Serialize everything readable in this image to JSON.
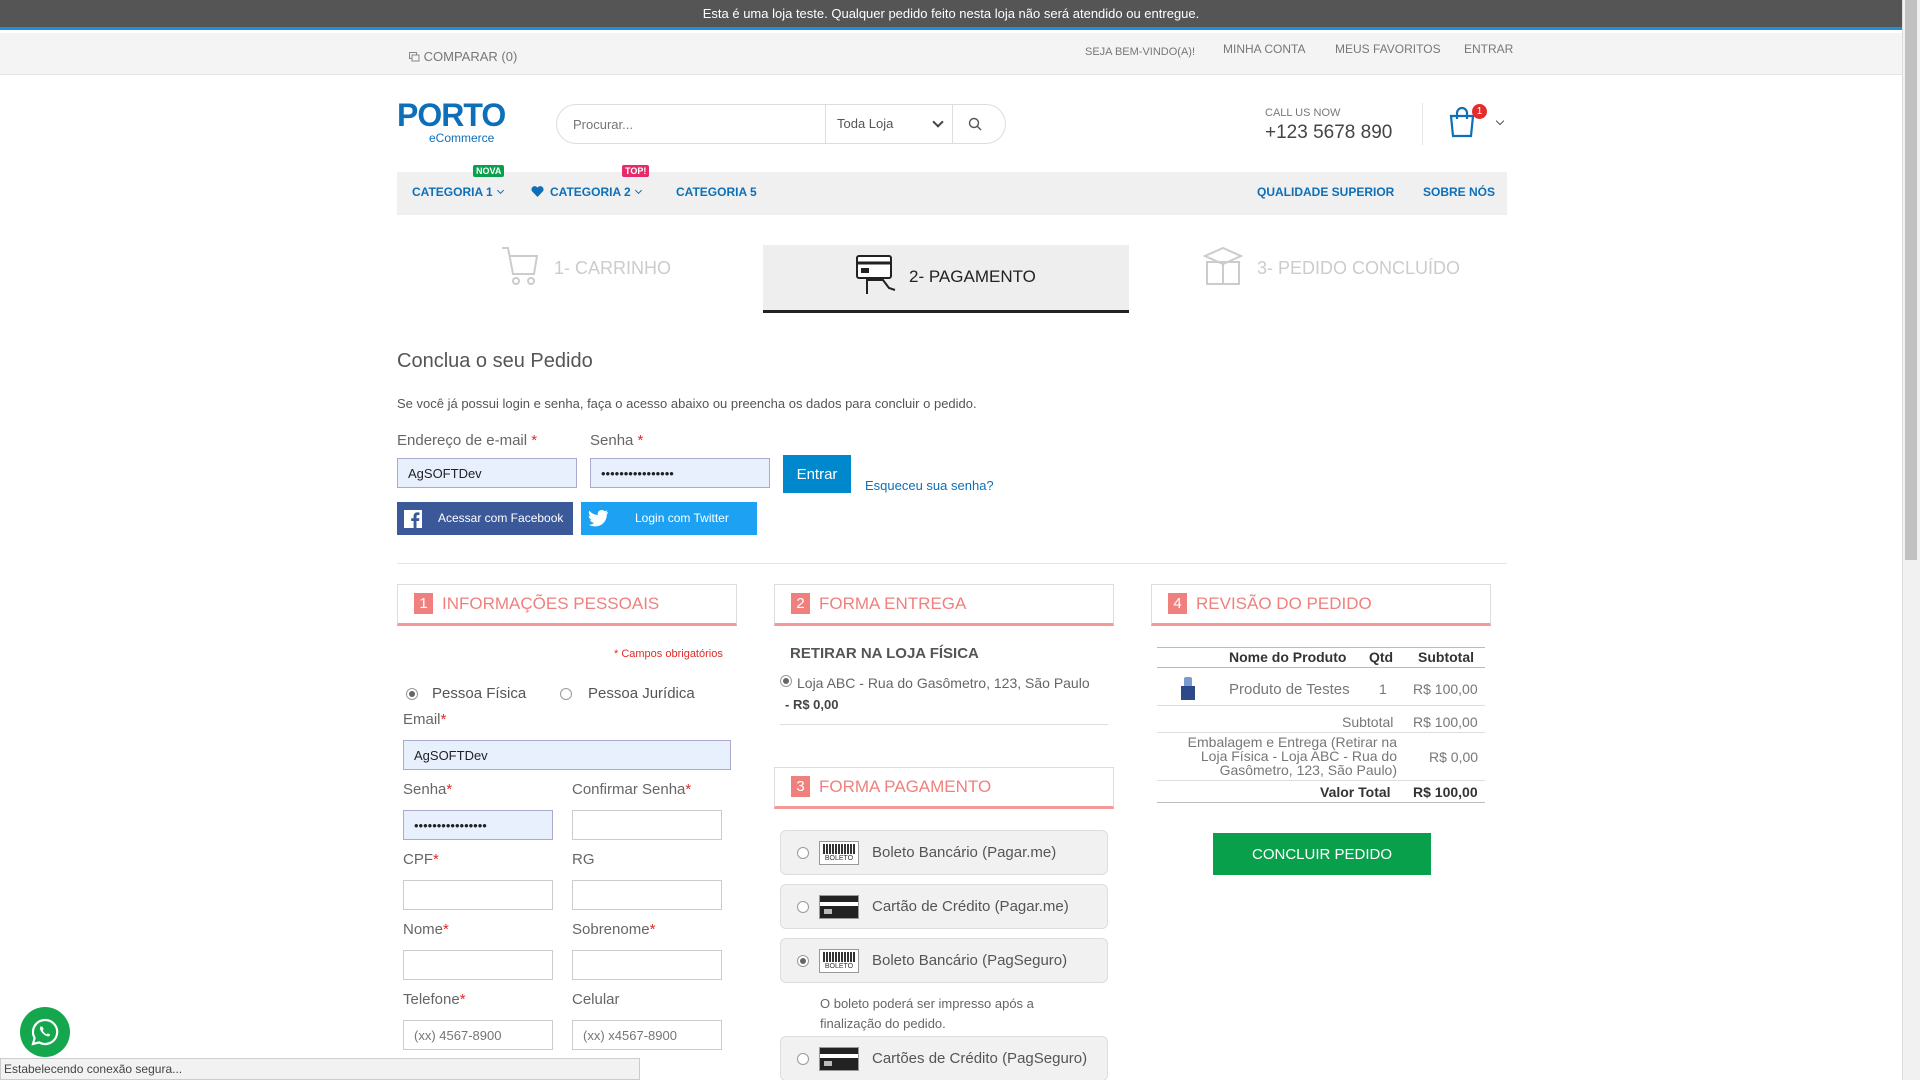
{
  "notice": "Esta é uma loja teste. Qualquer pedido feito nesta loja não será atendido ou entregue.",
  "toplinks": {
    "compare": "COMPARAR (0)",
    "welcome": "SEJA BEM-VINDO(A)!",
    "account": "MINHA CONTA",
    "favorites": "MEUS FAVORITOS",
    "login": "ENTRAR"
  },
  "header": {
    "logo": "PORTO",
    "logo_sub": "eCommerce",
    "search_placeholder": "Procurar...",
    "search_scope": "Toda Loja",
    "call_label": "CALL US NOW",
    "call_number": "+123 5678 890",
    "cart_count": "1"
  },
  "nav": {
    "cat1": "CATEGORIA 1",
    "cat1_tag": "NOVA",
    "cat2": "CATEGORIA 2",
    "cat2_tag": "TOP!",
    "cat5": "CATEGORIA 5",
    "quality": "QUALIDADE SUPERIOR",
    "about": "SOBRE NÓS"
  },
  "steps": [
    "1- CARRINHO",
    "2- PAGAMENTO",
    "3- PEDIDO CONCLUÍDO"
  ],
  "login": {
    "title": "Conclua o seu Pedido",
    "intro": "Se você já possui login e senha, faça o acesso abaixo ou preencha os dados para concluir o pedido.",
    "email_label": "Endereço de e-mail",
    "email_value": "AgSOFTDev",
    "password_label": "Senha",
    "password_value": "••••••••••••••••",
    "enter_button": "Entrar",
    "forgot": "Esqueceu sua senha?",
    "facebook": "Acessar com Facebook",
    "twitter": "Login com Twitter"
  },
  "personal": {
    "num": "1",
    "title": "INFORMAÇÕES PESSOAIS",
    "required_note": "* Campos obrigatórios",
    "type_fisica": "Pessoa Física",
    "type_juridica": "Pessoa Jurídica",
    "email_label": "Email",
    "email_value": "AgSOFTDev",
    "senha_label": "Senha",
    "senha_value": "••••••••••••••••",
    "confirm_label": "Confirmar Senha",
    "cpf_label": "CPF",
    "rg_label": "RG",
    "nome_label": "Nome",
    "sobrenome_label": "Sobrenome",
    "telefone_label": "Telefone",
    "telefone_placeholder": "(xx) 4567-8900",
    "celular_label": "Celular",
    "celular_placeholder": "(xx) x4567-8900"
  },
  "delivery": {
    "num": "2",
    "title": "FORMA ENTREGA",
    "subtitle": "RETIRAR NA LOJA FÍSICA",
    "option": "Loja ABC - Rua do Gasômetro, 123, São Paulo",
    "price_prefix": "- ",
    "price": "R$ 0,00"
  },
  "payment": {
    "num": "3",
    "title": "FORMA PAGAMENTO",
    "options": [
      "Boleto Bancário (Pagar.me)",
      "Cartão de Crédito (Pagar.me)",
      "Boleto Bancário (PagSeguro)",
      "Cartões de Crédito (PagSeguro)"
    ],
    "boleto_label": "BOLETO",
    "note_line1": "O boleto poderá ser impresso após a",
    "note_line2": "finalização do pedido."
  },
  "review": {
    "num": "4",
    "title": "REVISÃO DO PEDIDO",
    "col_product": "Nome do Produto",
    "col_qty": "Qtd",
    "col_subtotal": "Subtotal",
    "product_name": "Produto de Testes",
    "product_qty": "1",
    "product_subtotal": "R$ 100,00",
    "subtotal_label": "Subtotal",
    "subtotal_value": "R$ 100,00",
    "shipping_l1": "Embalagem e Entrega (Retirar na",
    "shipping_l2": "Loja Física - Loja ABC - Rua do",
    "shipping_l3": "Gasômetro, 123, São Paulo)",
    "shipping_value": "R$ 0,00",
    "total_label": "Valor Total",
    "total_value": "R$ 100,00",
    "button": "CONCLUIR PEDIDO"
  },
  "status_bar": "Estabelecendo conexão segura...",
  "colors": {
    "accent_blue": "#0d6fb8",
    "section_red": "#f0807e",
    "confirm_green": "#08a04b",
    "facebook": "#3b5998",
    "twitter": "#1da1f2"
  },
  "icons": [
    "compare-icon",
    "search-icon",
    "cart-icon",
    "heart-icon",
    "facebook-icon",
    "twitter-icon",
    "boleto-icon",
    "credit-card-icon",
    "whatsapp-icon"
  ]
}
